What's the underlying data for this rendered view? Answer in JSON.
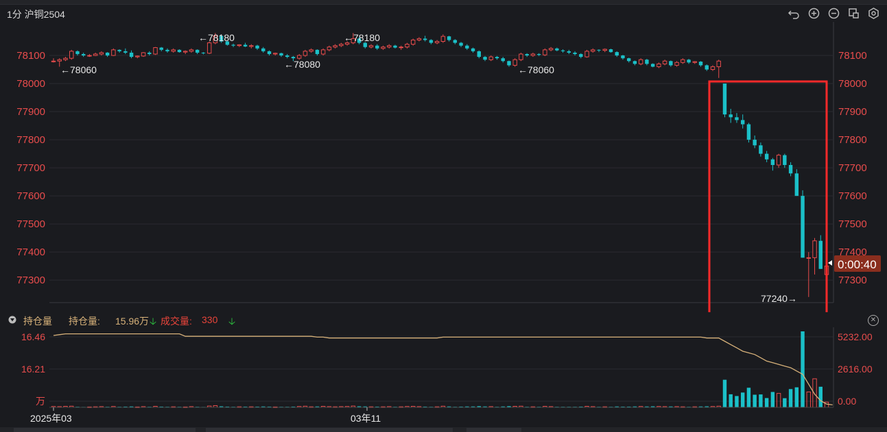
{
  "header": {
    "symbol": "1分 沪铜2504"
  },
  "icons": [
    "undo-icon",
    "zoom-in-icon",
    "zoom-out-icon",
    "layout-icon",
    "settings-icon"
  ],
  "colors": {
    "up": "#e84c4c",
    "down": "#1bc0c8",
    "grid": "#2a2b30",
    "axis_text": "#e84c4c",
    "highlight": "#ff2a2a",
    "oi_line": "#d8b27a",
    "countdown_bg": "#8a2e1e"
  },
  "countdown": "0:00:40",
  "annotations": {
    "a1": "←78060",
    "a2": "←78180",
    "a3": "←78080",
    "a4": "←78180",
    "a5": "←78060",
    "low": "77240→"
  },
  "volume_pane": {
    "title": "持仓量",
    "oi_label": "持仓量:",
    "oi_value": "15.96万",
    "vol_label": "成交量:",
    "vol_value": "330",
    "left_ticks": [
      "16.46",
      "16.21",
      "万"
    ],
    "right_ticks": [
      "5232.00",
      "2616.00",
      "0.00"
    ],
    "x_labels": [
      "2025年03",
      "03年11"
    ]
  },
  "chart_data": {
    "type": "candlestick",
    "title": "",
    "xlabel": "",
    "ylabel": "",
    "ylim": [
      77220,
      78200
    ],
    "y_ticks": [
      78100,
      78000,
      77900,
      77800,
      77700,
      77600,
      77500,
      77400,
      77300
    ],
    "candles": [
      [
        78080,
        78090,
        78075,
        78080
      ],
      [
        78080,
        78090,
        78060,
        78085
      ],
      [
        78085,
        78095,
        78080,
        78090
      ],
      [
        78090,
        78120,
        78085,
        78115
      ],
      [
        78115,
        78118,
        78100,
        78105
      ],
      [
        78105,
        78110,
        78095,
        78100
      ],
      [
        78100,
        78105,
        78095,
        78100
      ],
      [
        78100,
        78110,
        78098,
        78105
      ],
      [
        78105,
        78115,
        78100,
        78110
      ],
      [
        78110,
        78112,
        78095,
        78100
      ],
      [
        78100,
        78125,
        78098,
        78120
      ],
      [
        78120,
        78122,
        78110,
        78115
      ],
      [
        78115,
        78125,
        78105,
        78110
      ],
      [
        78110,
        78118,
        78090,
        78095
      ],
      [
        78095,
        78100,
        78090,
        78098
      ],
      [
        78098,
        78112,
        78095,
        78110
      ],
      [
        78110,
        78115,
        78100,
        78105
      ],
      [
        78105,
        78130,
        78102,
        78128
      ],
      [
        78128,
        78130,
        78115,
        78120
      ],
      [
        78120,
        78125,
        78110,
        78115
      ],
      [
        78115,
        78125,
        78110,
        78120
      ],
      [
        78120,
        78122,
        78110,
        78112
      ],
      [
        78112,
        78118,
        78105,
        78115
      ],
      [
        78115,
        78125,
        78110,
        78120
      ],
      [
        78120,
        78122,
        78105,
        78110
      ],
      [
        78110,
        78112,
        78104,
        78108
      ],
      [
        78108,
        78150,
        78105,
        78145
      ],
      [
        78145,
        78180,
        78140,
        78170
      ],
      [
        78170,
        78175,
        78145,
        78150
      ],
      [
        78150,
        78152,
        78135,
        78138
      ],
      [
        78138,
        78142,
        78130,
        78135
      ],
      [
        78135,
        78140,
        78130,
        78138
      ],
      [
        78138,
        78145,
        78130,
        78132
      ],
      [
        78132,
        78140,
        78125,
        78135
      ],
      [
        78135,
        78138,
        78120,
        78125
      ],
      [
        78125,
        78130,
        78110,
        78115
      ],
      [
        78115,
        78118,
        78100,
        78105
      ],
      [
        78105,
        78110,
        78100,
        78108
      ],
      [
        78108,
        78110,
        78095,
        78100
      ],
      [
        78100,
        78105,
        78090,
        78095
      ],
      [
        78095,
        78098,
        78080,
        78090
      ],
      [
        78090,
        78105,
        78085,
        78100
      ],
      [
        78100,
        78120,
        78095,
        78115
      ],
      [
        78115,
        78125,
        78110,
        78120
      ],
      [
        78120,
        78122,
        78100,
        78105
      ],
      [
        78105,
        78125,
        78100,
        78120
      ],
      [
        78120,
        78135,
        78115,
        78130
      ],
      [
        78130,
        78140,
        78125,
        78135
      ],
      [
        78135,
        78145,
        78130,
        78140
      ],
      [
        78140,
        78150,
        78135,
        78145
      ],
      [
        78145,
        78180,
        78140,
        78160
      ],
      [
        78160,
        78165,
        78140,
        78145
      ],
      [
        78145,
        78148,
        78125,
        78130
      ],
      [
        78130,
        78140,
        78125,
        78135
      ],
      [
        78135,
        78140,
        78120,
        78125
      ],
      [
        78125,
        78135,
        78120,
        78130
      ],
      [
        78130,
        78140,
        78125,
        78135
      ],
      [
        78135,
        78138,
        78125,
        78128
      ],
      [
        78128,
        78135,
        78120,
        78130
      ],
      [
        78130,
        78145,
        78125,
        78140
      ],
      [
        78140,
        78160,
        78135,
        78155
      ],
      [
        78155,
        78165,
        78150,
        78160
      ],
      [
        78160,
        78170,
        78150,
        78155
      ],
      [
        78155,
        78158,
        78140,
        78145
      ],
      [
        78145,
        78155,
        78140,
        78150
      ],
      [
        78150,
        78175,
        78145,
        78168
      ],
      [
        78168,
        78170,
        78150,
        78155
      ],
      [
        78155,
        78158,
        78140,
        78145
      ],
      [
        78145,
        78148,
        78130,
        78135
      ],
      [
        78135,
        78140,
        78120,
        78125
      ],
      [
        78125,
        78128,
        78110,
        78115
      ],
      [
        78115,
        78118,
        78090,
        78095
      ],
      [
        78095,
        78098,
        78080,
        78085
      ],
      [
        78085,
        78100,
        78080,
        78095
      ],
      [
        78095,
        78098,
        78085,
        78090
      ],
      [
        78090,
        78095,
        78075,
        78080
      ],
      [
        78080,
        78082,
        78060,
        78065
      ],
      [
        78065,
        78090,
        78060,
        78085
      ],
      [
        78085,
        78110,
        78080,
        78105
      ],
      [
        78105,
        78108,
        78095,
        78100
      ],
      [
        78100,
        78110,
        78095,
        78105
      ],
      [
        78105,
        78108,
        78098,
        78102
      ],
      [
        78102,
        78125,
        78098,
        78120
      ],
      [
        78120,
        78130,
        78115,
        78125
      ],
      [
        78125,
        78128,
        78115,
        78118
      ],
      [
        78118,
        78122,
        78110,
        78115
      ],
      [
        78115,
        78120,
        78105,
        78110
      ],
      [
        78110,
        78115,
        78100,
        78105
      ],
      [
        78105,
        78108,
        78090,
        78095
      ],
      [
        78095,
        78120,
        78092,
        78115
      ],
      [
        78115,
        78125,
        78110,
        78120
      ],
      [
        78120,
        78122,
        78112,
        78118
      ],
      [
        78118,
        78125,
        78112,
        78122
      ],
      [
        78122,
        78124,
        78110,
        78112
      ],
      [
        78112,
        78115,
        78095,
        78100
      ],
      [
        78100,
        78102,
        78085,
        78090
      ],
      [
        78090,
        78092,
        78075,
        78080
      ],
      [
        78080,
        78082,
        78065,
        78070
      ],
      [
        78070,
        78090,
        78065,
        78085
      ],
      [
        78085,
        78088,
        78065,
        78070
      ],
      [
        78070,
        78072,
        78058,
        78060
      ],
      [
        78060,
        78075,
        78055,
        78070
      ],
      [
        78070,
        78085,
        78065,
        78080
      ],
      [
        78080,
        78082,
        78060,
        78065
      ],
      [
        78065,
        78080,
        78060,
        78075
      ],
      [
        78075,
        78090,
        78070,
        78085
      ],
      [
        78085,
        78088,
        78070,
        78075
      ],
      [
        78075,
        78080,
        78070,
        78078
      ],
      [
        78078,
        78080,
        78060,
        78065
      ],
      [
        78065,
        78068,
        78045,
        78050
      ],
      [
        78050,
        78065,
        78045,
        78060
      ],
      [
        78060,
        78085,
        78020,
        78080
      ],
      [
        78000,
        78000,
        77880,
        77890
      ],
      [
        77890,
        77910,
        77860,
        77880
      ],
      [
        77880,
        77895,
        77860,
        77870
      ],
      [
        77870,
        77890,
        77840,
        77855
      ],
      [
        77855,
        77860,
        77790,
        77800
      ],
      [
        77800,
        77815,
        77770,
        77780
      ],
      [
        77780,
        77790,
        77740,
        77750
      ],
      [
        77750,
        77760,
        77720,
        77730
      ],
      [
        77730,
        77735,
        77690,
        77710
      ],
      [
        77710,
        77750,
        77700,
        77745
      ],
      [
        77745,
        77750,
        77700,
        77710
      ],
      [
        77710,
        77720,
        77670,
        77680
      ],
      [
        77680,
        77695,
        77600,
        77600
      ],
      [
        77600,
        77620,
        77380,
        77380
      ],
      [
        77380,
        77400,
        77240,
        77380
      ],
      [
        77380,
        77450,
        77320,
        77440
      ],
      [
        77440,
        77460,
        77340,
        77340
      ],
      [
        77320,
        77360,
        77310,
        77350
      ]
    ],
    "volume": [
      60,
      50,
      70,
      80,
      40,
      30,
      30,
      40,
      50,
      40,
      60,
      40,
      50,
      60,
      30,
      50,
      40,
      70,
      50,
      40,
      40,
      40,
      30,
      50,
      40,
      30,
      90,
      120,
      70,
      50,
      40,
      40,
      50,
      40,
      50,
      60,
      50,
      30,
      40,
      40,
      50,
      60,
      80,
      40,
      60,
      70,
      50,
      40,
      50,
      60,
      90,
      70,
      60,
      40,
      50,
      40,
      50,
      40,
      40,
      60,
      70,
      50,
      50,
      40,
      40,
      80,
      60,
      40,
      50,
      60,
      60,
      80,
      60,
      50,
      40,
      60,
      80,
      70,
      80,
      40,
      40,
      40,
      70,
      50,
      40,
      40,
      40,
      40,
      50,
      70,
      50,
      40,
      40,
      40,
      60,
      50,
      50,
      60,
      60,
      60,
      70,
      60,
      50,
      60,
      50,
      40,
      40,
      40,
      60,
      70,
      60,
      80,
      1900,
      900,
      780,
      1020,
      1350,
      870,
      890,
      640,
      1060,
      960,
      630,
      1260,
      1380,
      5232,
      1060,
      1970,
      1420,
      360
    ],
    "oi_ylim": [
      16.02,
      16.48
    ],
    "oi_line": [
      16.455,
      16.46,
      16.465,
      16.465,
      16.465,
      16.465,
      16.465,
      16.465,
      16.465,
      16.465,
      16.465,
      16.465,
      16.465,
      16.465,
      16.465,
      16.465,
      16.465,
      16.465,
      16.465,
      16.465,
      16.465,
      16.465,
      16.45,
      16.45,
      16.45,
      16.45,
      16.45,
      16.45,
      16.45,
      16.45,
      16.45,
      16.45,
      16.45,
      16.45,
      16.45,
      16.45,
      16.45,
      16.45,
      16.45,
      16.45,
      16.45,
      16.45,
      16.45,
      16.45,
      16.445,
      16.445,
      16.44,
      16.44,
      16.44,
      16.44,
      16.44,
      16.44,
      16.44,
      16.44,
      16.44,
      16.44,
      16.44,
      16.44,
      16.44,
      16.44,
      16.44,
      16.44,
      16.44,
      16.44,
      16.44,
      16.445,
      16.445,
      16.445,
      16.445,
      16.445,
      16.445,
      16.445,
      16.445,
      16.445,
      16.445,
      16.445,
      16.445,
      16.445,
      16.445,
      16.445,
      16.445,
      16.445,
      16.445,
      16.445,
      16.445,
      16.445,
      16.445,
      16.445,
      16.445,
      16.445,
      16.445,
      16.445,
      16.445,
      16.445,
      16.445,
      16.445,
      16.445,
      16.445,
      16.445,
      16.445,
      16.445,
      16.445,
      16.445,
      16.445,
      16.445,
      16.445,
      16.445,
      16.445,
      16.445,
      16.44,
      16.44,
      16.44,
      16.42,
      16.4,
      16.38,
      16.36,
      16.35,
      16.34,
      16.32,
      16.3,
      16.29,
      16.28,
      16.27,
      16.26,
      16.24,
      16.22,
      16.16,
      16.1,
      16.06,
      16.04,
      16.035
    ]
  }
}
